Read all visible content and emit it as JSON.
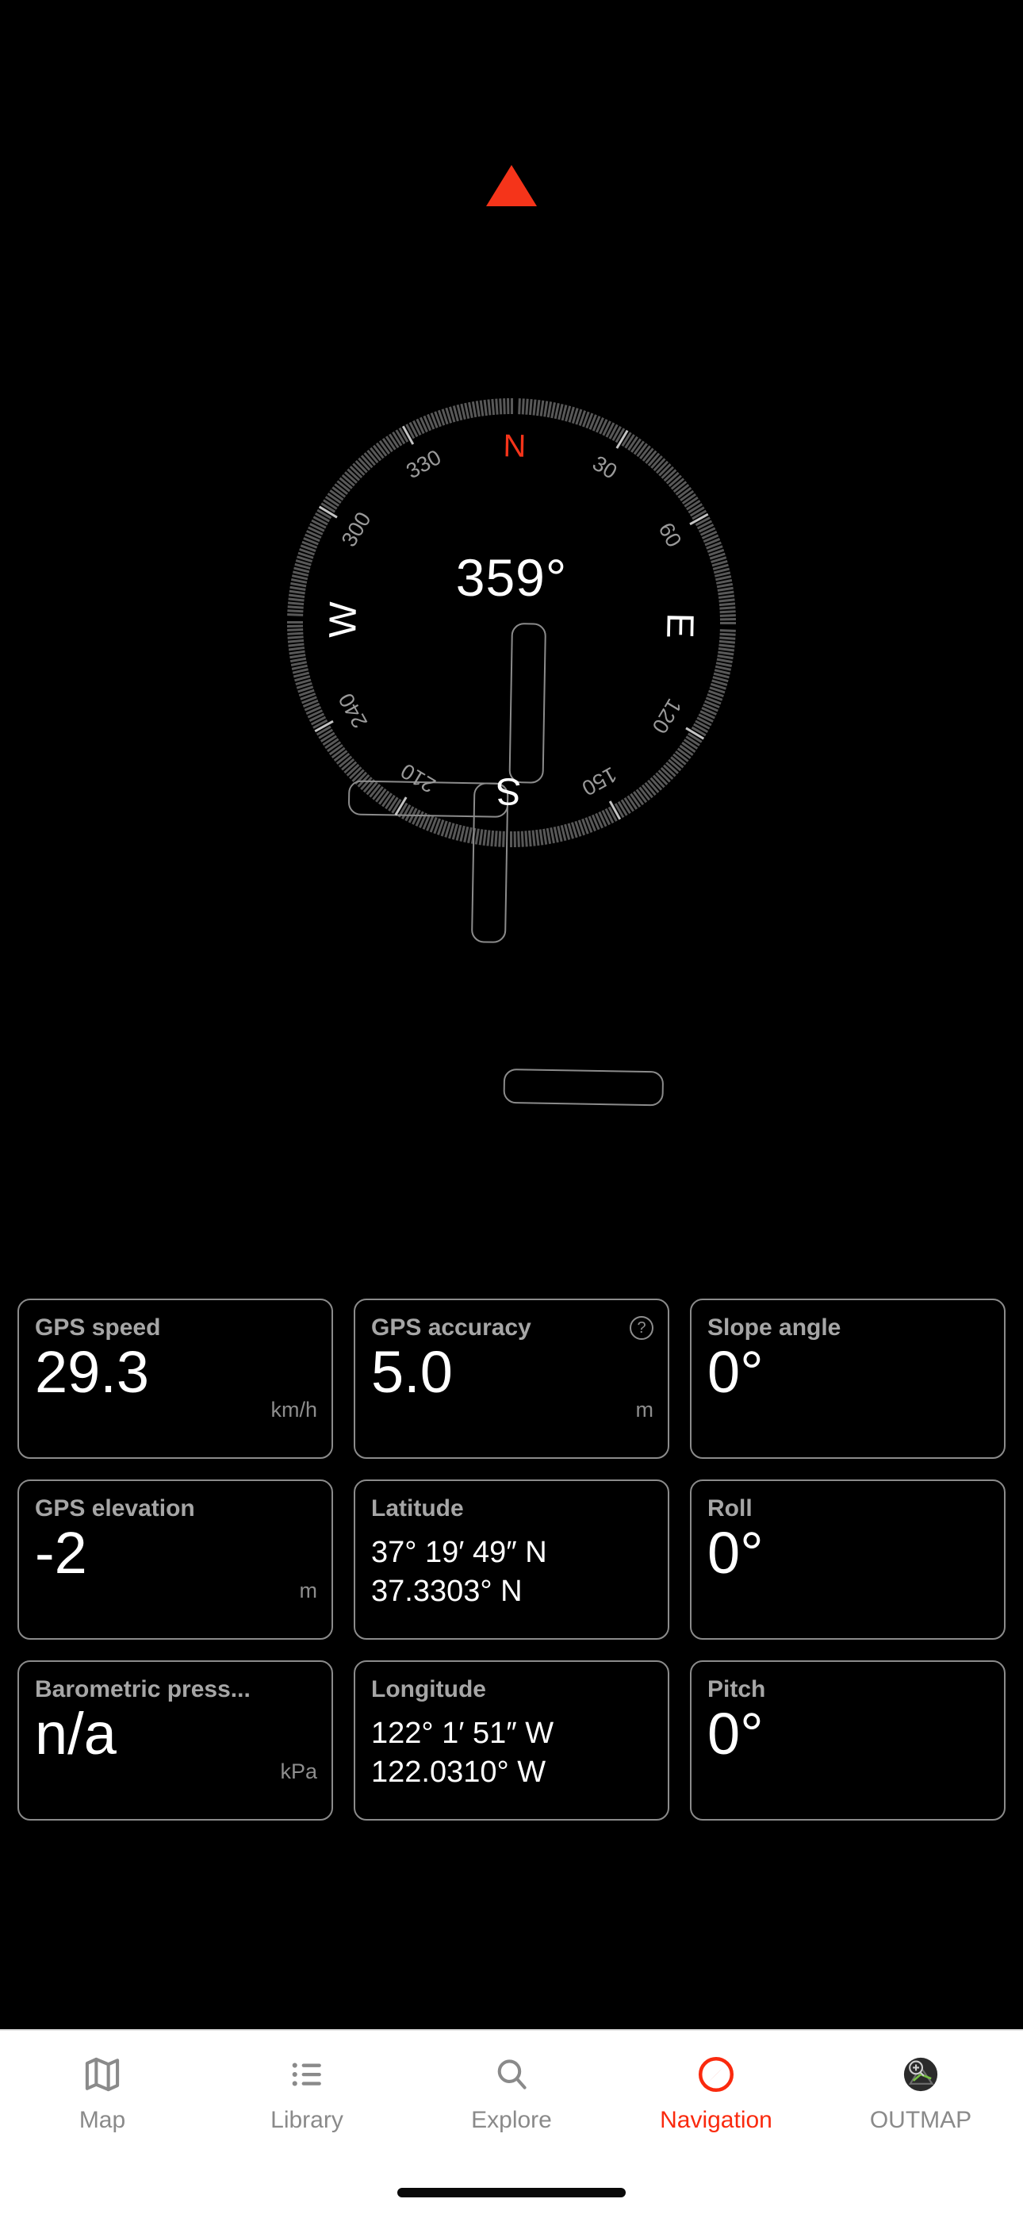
{
  "compass": {
    "heading": "359°",
    "pointer_color": "#f5341a",
    "north_label": "N",
    "cardinals": [
      {
        "label": "N",
        "angle": 0,
        "is_north": true
      },
      {
        "label": "E",
        "angle": 90,
        "is_north": false
      },
      {
        "label": "S",
        "angle": 180,
        "is_north": false
      },
      {
        "label": "W",
        "angle": 270,
        "is_north": false
      }
    ],
    "degree_labels": [
      {
        "label": "30",
        "angle": 30
      },
      {
        "label": "60",
        "angle": 60
      },
      {
        "label": "120",
        "angle": 120
      },
      {
        "label": "150",
        "angle": 150
      },
      {
        "label": "210",
        "angle": 210
      },
      {
        "label": "240",
        "angle": 240
      },
      {
        "label": "300",
        "angle": 300
      },
      {
        "label": "330",
        "angle": 330
      }
    ],
    "dial_rotation_deg": 1
  },
  "cards": {
    "rows": [
      [
        {
          "title": "GPS speed",
          "value": "29.3",
          "unit": "km/h",
          "help": false
        },
        {
          "title": "GPS accuracy",
          "value": "5.0",
          "unit": "m",
          "help": true,
          "help_glyph": "?"
        },
        {
          "title": "Slope angle",
          "value": "0°",
          "unit": "",
          "help": false
        }
      ],
      [
        {
          "title": "GPS elevation",
          "value": "-2",
          "unit": "m",
          "help": false
        },
        {
          "title": "Latitude",
          "coords": [
            "37° 19′ 49″ N",
            "37.3303° N"
          ],
          "help": false
        },
        {
          "title": "Roll",
          "value": "0°",
          "unit": "",
          "help": false
        }
      ],
      [
        {
          "title": "Barometric press...",
          "value": "n/a",
          "unit": "kPa",
          "help": false
        },
        {
          "title": "Longitude",
          "coords": [
            "122° 1′ 51″ W",
            "122.0310° W"
          ],
          "help": false
        },
        {
          "title": "Pitch",
          "value": "0°",
          "unit": "",
          "help": false
        }
      ]
    ]
  },
  "tabbar": {
    "active_color": "#fa2a0e",
    "inactive_color": "#8a8a8a",
    "items": [
      {
        "label": "Map",
        "icon": "map-icon",
        "active": false
      },
      {
        "label": "Library",
        "icon": "list-icon",
        "active": false
      },
      {
        "label": "Explore",
        "icon": "search-icon",
        "active": false
      },
      {
        "label": "Navigation",
        "icon": "compass-icon",
        "active": true
      },
      {
        "label": "OUTMAP",
        "icon": "outmap-logo-icon",
        "active": false
      }
    ]
  }
}
